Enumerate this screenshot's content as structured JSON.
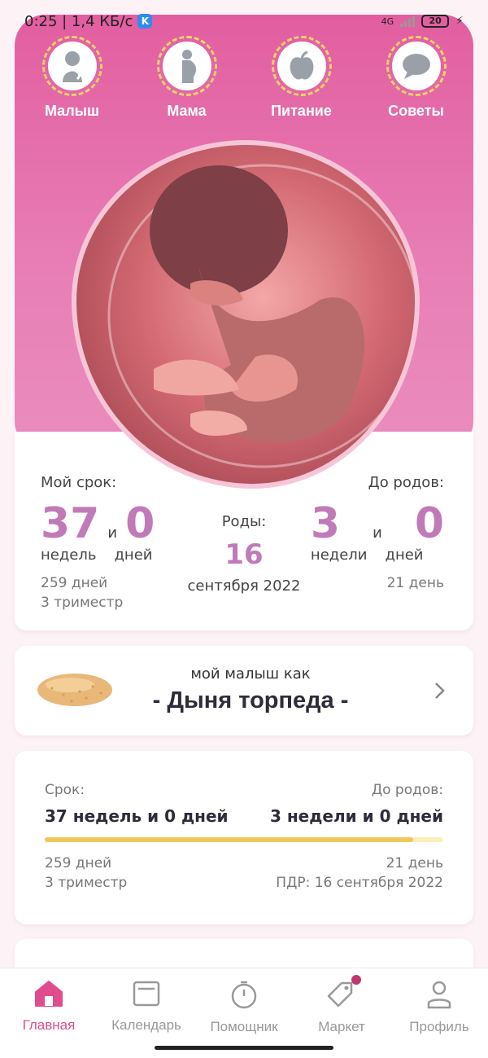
{
  "status_bar": {
    "time_speed": "0:25 | 1,4 КБ/с",
    "k_badge": "K",
    "network": "4G",
    "battery": "20"
  },
  "top_nav": [
    {
      "label": "Малыш",
      "icon": "baby-icon"
    },
    {
      "label": "Мама",
      "icon": "pregnant-mother-icon"
    },
    {
      "label": "Питание",
      "icon": "apple-icon"
    },
    {
      "label": "Советы",
      "icon": "chat-bubble-icon"
    }
  ],
  "term": {
    "title": "Мой срок:",
    "weeks": "37",
    "and": "и",
    "days": "0",
    "weeks_label": "недель",
    "days_label": "дней",
    "total_days": "259 дней",
    "trimester": "3 триместр"
  },
  "birth": {
    "title": "Роды:",
    "day": "16",
    "month_year": "сентября 2022"
  },
  "until_birth": {
    "title": "До родов:",
    "weeks": "3",
    "and": "и",
    "days": "0",
    "weeks_label": "недели",
    "days_label": "дней",
    "total_days": "21 день"
  },
  "fruit_card": {
    "caption": "мой малыш как",
    "name": "- Дыня торпеда -"
  },
  "progress_card": {
    "term_label": "Срок:",
    "term_value": "37 недель и 0 дней",
    "until_label": "До родов:",
    "until_value": "3 недели и 0 дней",
    "progress_percent": 92.5,
    "left_days": "259 дней",
    "left_trimester": "3 триместр",
    "right_days": "21 день",
    "due_date": "ПДР: 16 сентября 2022"
  },
  "bottom_nav": [
    {
      "label": "Главная",
      "icon": "home-icon",
      "active": true
    },
    {
      "label": "Календарь",
      "icon": "calendar-icon"
    },
    {
      "label": "Помощник",
      "icon": "timer-icon"
    },
    {
      "label": "Маркет",
      "icon": "price-tag-icon",
      "badge": true
    },
    {
      "label": "Профиль",
      "icon": "profile-icon"
    }
  ],
  "colors": {
    "accent": "#e04c8c",
    "number": "#c17ab8",
    "progress": "#f0c85a",
    "hero": "#e25ea0"
  }
}
